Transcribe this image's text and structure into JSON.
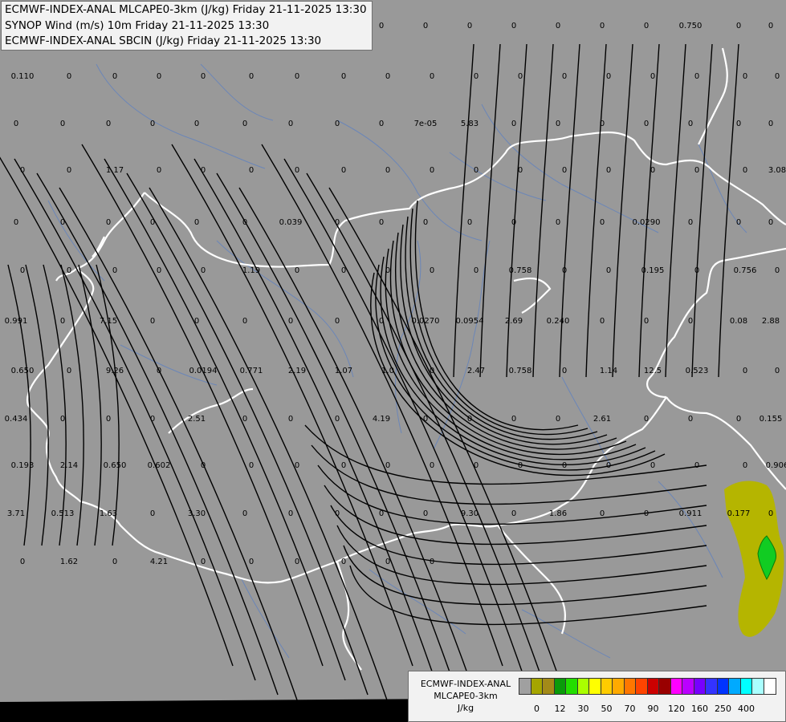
{
  "header": {
    "lines": [
      "ECMWF-INDEX-ANAL MLCAPE0-3km (J/kg) Friday 21-11-2025 13:30",
      "SYNOP Wind (m/s) 10m Friday 21-11-2025 13:30",
      "ECMWF-INDEX-ANAL SBCIN (J/kg) Friday 21-11-2025 13:30"
    ]
  },
  "colors": {
    "background": "#999999",
    "border": "#ffffff",
    "river": "#6b86b8",
    "streamline": "#000000",
    "shade_low": "#b5b500",
    "shade_high": "#11cc22"
  },
  "legend": {
    "title_lines": [
      "ECMWF-INDEX-ANAL",
      "MLCAPE0-3km",
      "J/kg"
    ],
    "swatches": [
      "#a0a0a0",
      "#a5a500",
      "#a38a18",
      "#0a9a0a",
      "#22dd00",
      "#aaff00",
      "#ffff00",
      "#ffcc00",
      "#ffaa00",
      "#ff7700",
      "#ff4400",
      "#cc0000",
      "#990000",
      "#ff00ff",
      "#bb00ff",
      "#7700ff",
      "#3333ff",
      "#0033ff",
      "#00aaff",
      "#00ffff",
      "#aaffff",
      "#ffffff"
    ],
    "ticks": [
      "0",
      "12",
      "30",
      "50",
      "70",
      "90",
      "120",
      "160",
      "250",
      "400"
    ]
  },
  "values": [
    "0",
    "0",
    "0",
    "0",
    "0",
    "0",
    "0",
    "0.750",
    "0",
    "0",
    "0.110",
    "0",
    "0",
    "0",
    "0",
    "0",
    "0",
    "0",
    "0",
    "0",
    "0",
    "0",
    "0",
    "0",
    "0",
    "0",
    "0",
    "0",
    "0",
    "0",
    "0",
    "0",
    "0",
    "0",
    "0",
    "0",
    "0",
    "7e-05",
    "5.83",
    "0",
    "0",
    "0",
    "0",
    "0",
    "0",
    "0",
    "0",
    "0",
    "1.17",
    "0",
    "0",
    "0",
    "0",
    "0",
    "0",
    "0",
    "0",
    "0",
    "0",
    "0",
    "0",
    "0",
    "0",
    "3.08",
    "0",
    "0",
    "0",
    "0",
    "0",
    "0",
    "0.039",
    "0",
    "0",
    "0",
    "0",
    "0",
    "0",
    "0",
    "0.0290",
    "0",
    "0",
    "0",
    "0",
    "0",
    "0",
    "0",
    "0",
    "1.19",
    "0",
    "0",
    "0",
    "0",
    "0",
    "0.758",
    "0",
    "0",
    "0.195",
    "0",
    "0.756",
    "0",
    "0.991",
    "0",
    "7.15",
    "0",
    "0",
    "0",
    "0",
    "0",
    "0",
    "0.0270",
    "0.0954",
    "2.69",
    "0.240",
    "0",
    "0",
    "0",
    "0.08",
    "2.88",
    "0.650",
    "0",
    "9.26",
    "0",
    "0.0194",
    "0.771",
    "2.19",
    "1.07",
    "1.0",
    "0",
    "2.47",
    "0.758",
    "0",
    "1.14",
    "12.5",
    "0.523",
    "0",
    "0",
    "0.434",
    "0",
    "0",
    "0",
    "2.51",
    "0",
    "0",
    "0",
    "4.19",
    "0",
    "0",
    "0",
    "0",
    "2.61",
    "0",
    "0",
    "0",
    "0.155",
    "0.193",
    "2.14",
    "0.650",
    "0.602",
    "0",
    "0",
    "0",
    "0",
    "0",
    "0",
    "0",
    "0",
    "0",
    "0",
    "0",
    "0",
    "0",
    "0.906",
    "3.71",
    "0.513",
    "1.63",
    "0",
    "3.30",
    "0",
    "0",
    "0",
    "0",
    "0",
    "9.30",
    "0",
    "1.86",
    "0",
    "0",
    "0.911",
    "0.177",
    "0",
    "0",
    "1.62",
    "0",
    "4.21",
    "0",
    "0",
    "0",
    "0",
    "0",
    "0"
  ]
}
